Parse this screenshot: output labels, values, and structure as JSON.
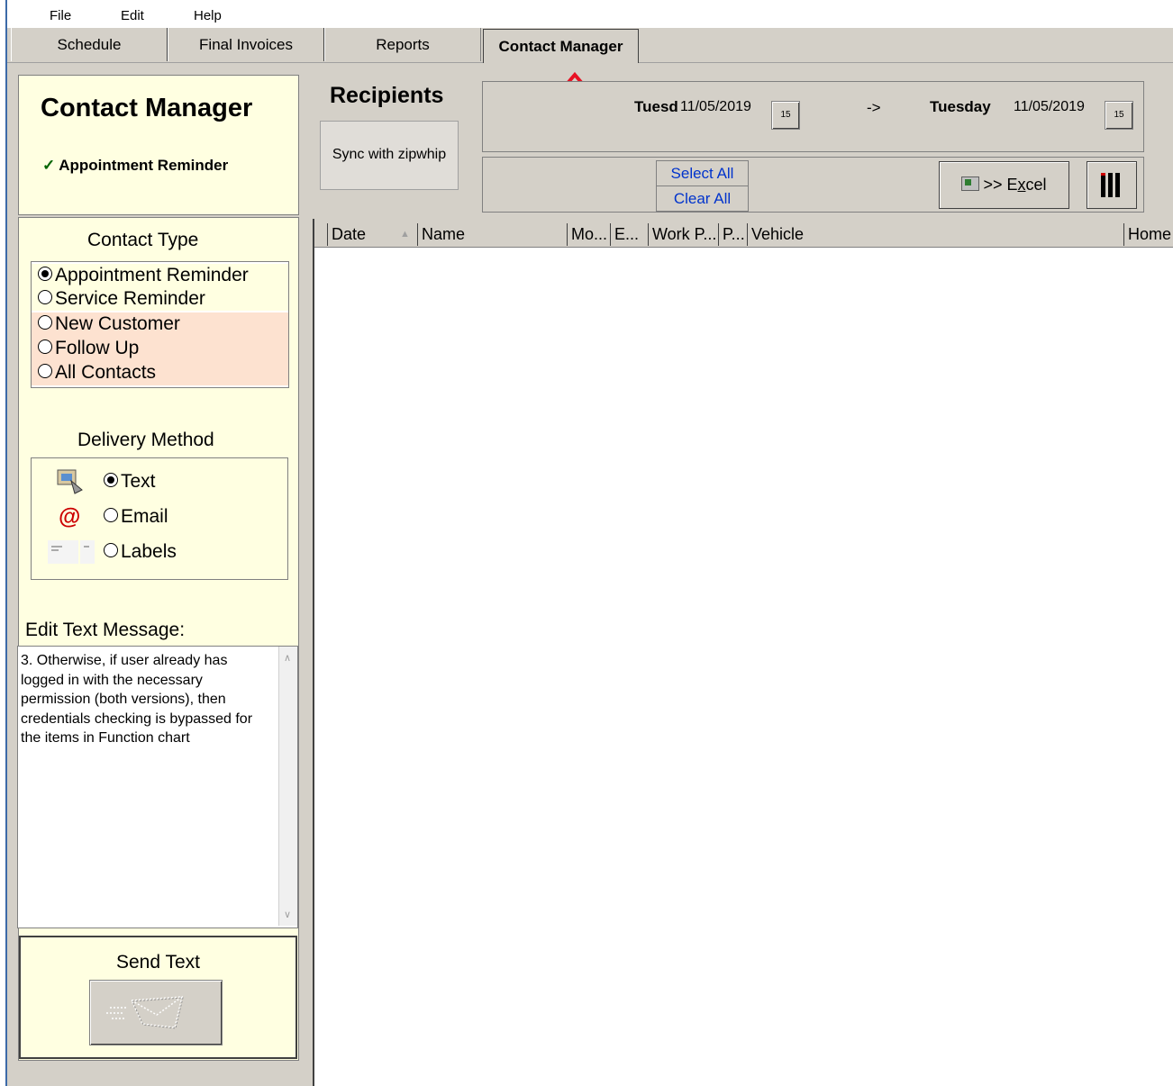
{
  "menu": {
    "file": "File",
    "edit": "Edit",
    "help": "Help"
  },
  "tabs": [
    {
      "label": "Schedule"
    },
    {
      "label": "Final Invoices"
    },
    {
      "label": "Reports"
    },
    {
      "label": "Contact Manager"
    }
  ],
  "header": {
    "title": "Contact Manager",
    "checkmark": "✓",
    "subtitle": "Appointment Reminder"
  },
  "recipients": {
    "title": "Recipients",
    "sync_label": "Sync with zipwhip"
  },
  "dates": {
    "from_label": "Tuesd",
    "from_date": "11/05/2019",
    "arrow": "->",
    "to_label": "Tuesday",
    "to_date": "11/05/2019",
    "cal_icon": "15"
  },
  "select": {
    "select_all": "Select All",
    "clear_all": "Clear All"
  },
  "excel": {
    "label_prefix": ">> E",
    "label_underline": "x",
    "label_suffix": "cel"
  },
  "contact_type": {
    "title": "Contact Type",
    "options": [
      {
        "label": "Appointment Reminder",
        "checked": true
      },
      {
        "label": "Service Reminder",
        "checked": false
      },
      {
        "label": "New Customer",
        "checked": false
      },
      {
        "label": "Follow Up",
        "checked": false
      },
      {
        "label": "All Contacts",
        "checked": false
      }
    ]
  },
  "delivery": {
    "title": "Delivery Method",
    "options": [
      {
        "label": "Text",
        "checked": true,
        "icon": "text-message-icon"
      },
      {
        "label": "Email",
        "checked": false,
        "icon": "at-sign-icon",
        "glyph": "@"
      },
      {
        "label": "Labels",
        "checked": false,
        "icon": "labels-icon"
      }
    ]
  },
  "message": {
    "title": "Edit Text Message:",
    "text": "3. Otherwise, if user already has logged in with the necessary permission (both versions), then credentials checking is bypassed for the items in Function chart"
  },
  "send": {
    "title": "Send Text"
  },
  "grid": {
    "columns": [
      "Date",
      "Name",
      "Mo...",
      "E...",
      "Work P...",
      "P...",
      "Vehicle",
      "Home"
    ]
  },
  "colors": {
    "panel_yellow": "#ffffe1",
    "panel_pink": "#fde2d0",
    "link_blue": "#0033cc",
    "arrow_red": "#e81123",
    "email_red": "#cc0000"
  }
}
